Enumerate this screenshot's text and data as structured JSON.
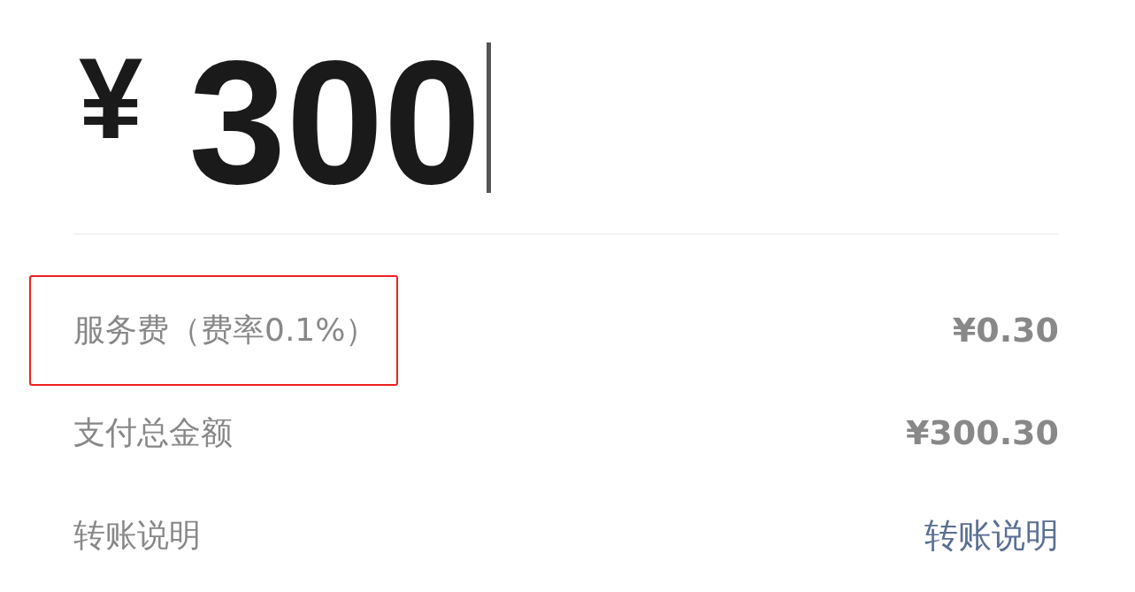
{
  "amount": {
    "currency": "¥",
    "value": "300",
    "focused": true
  },
  "rows": [
    {
      "label": "服务费（费率0.1%）",
      "value": "¥0.30",
      "kind": "text",
      "highlighted": true
    },
    {
      "label": "支付总金额",
      "value": "¥300.30",
      "kind": "text",
      "highlighted": false
    },
    {
      "label": "转账说明",
      "value": "转账说明",
      "kind": "link",
      "highlighted": false
    }
  ]
}
